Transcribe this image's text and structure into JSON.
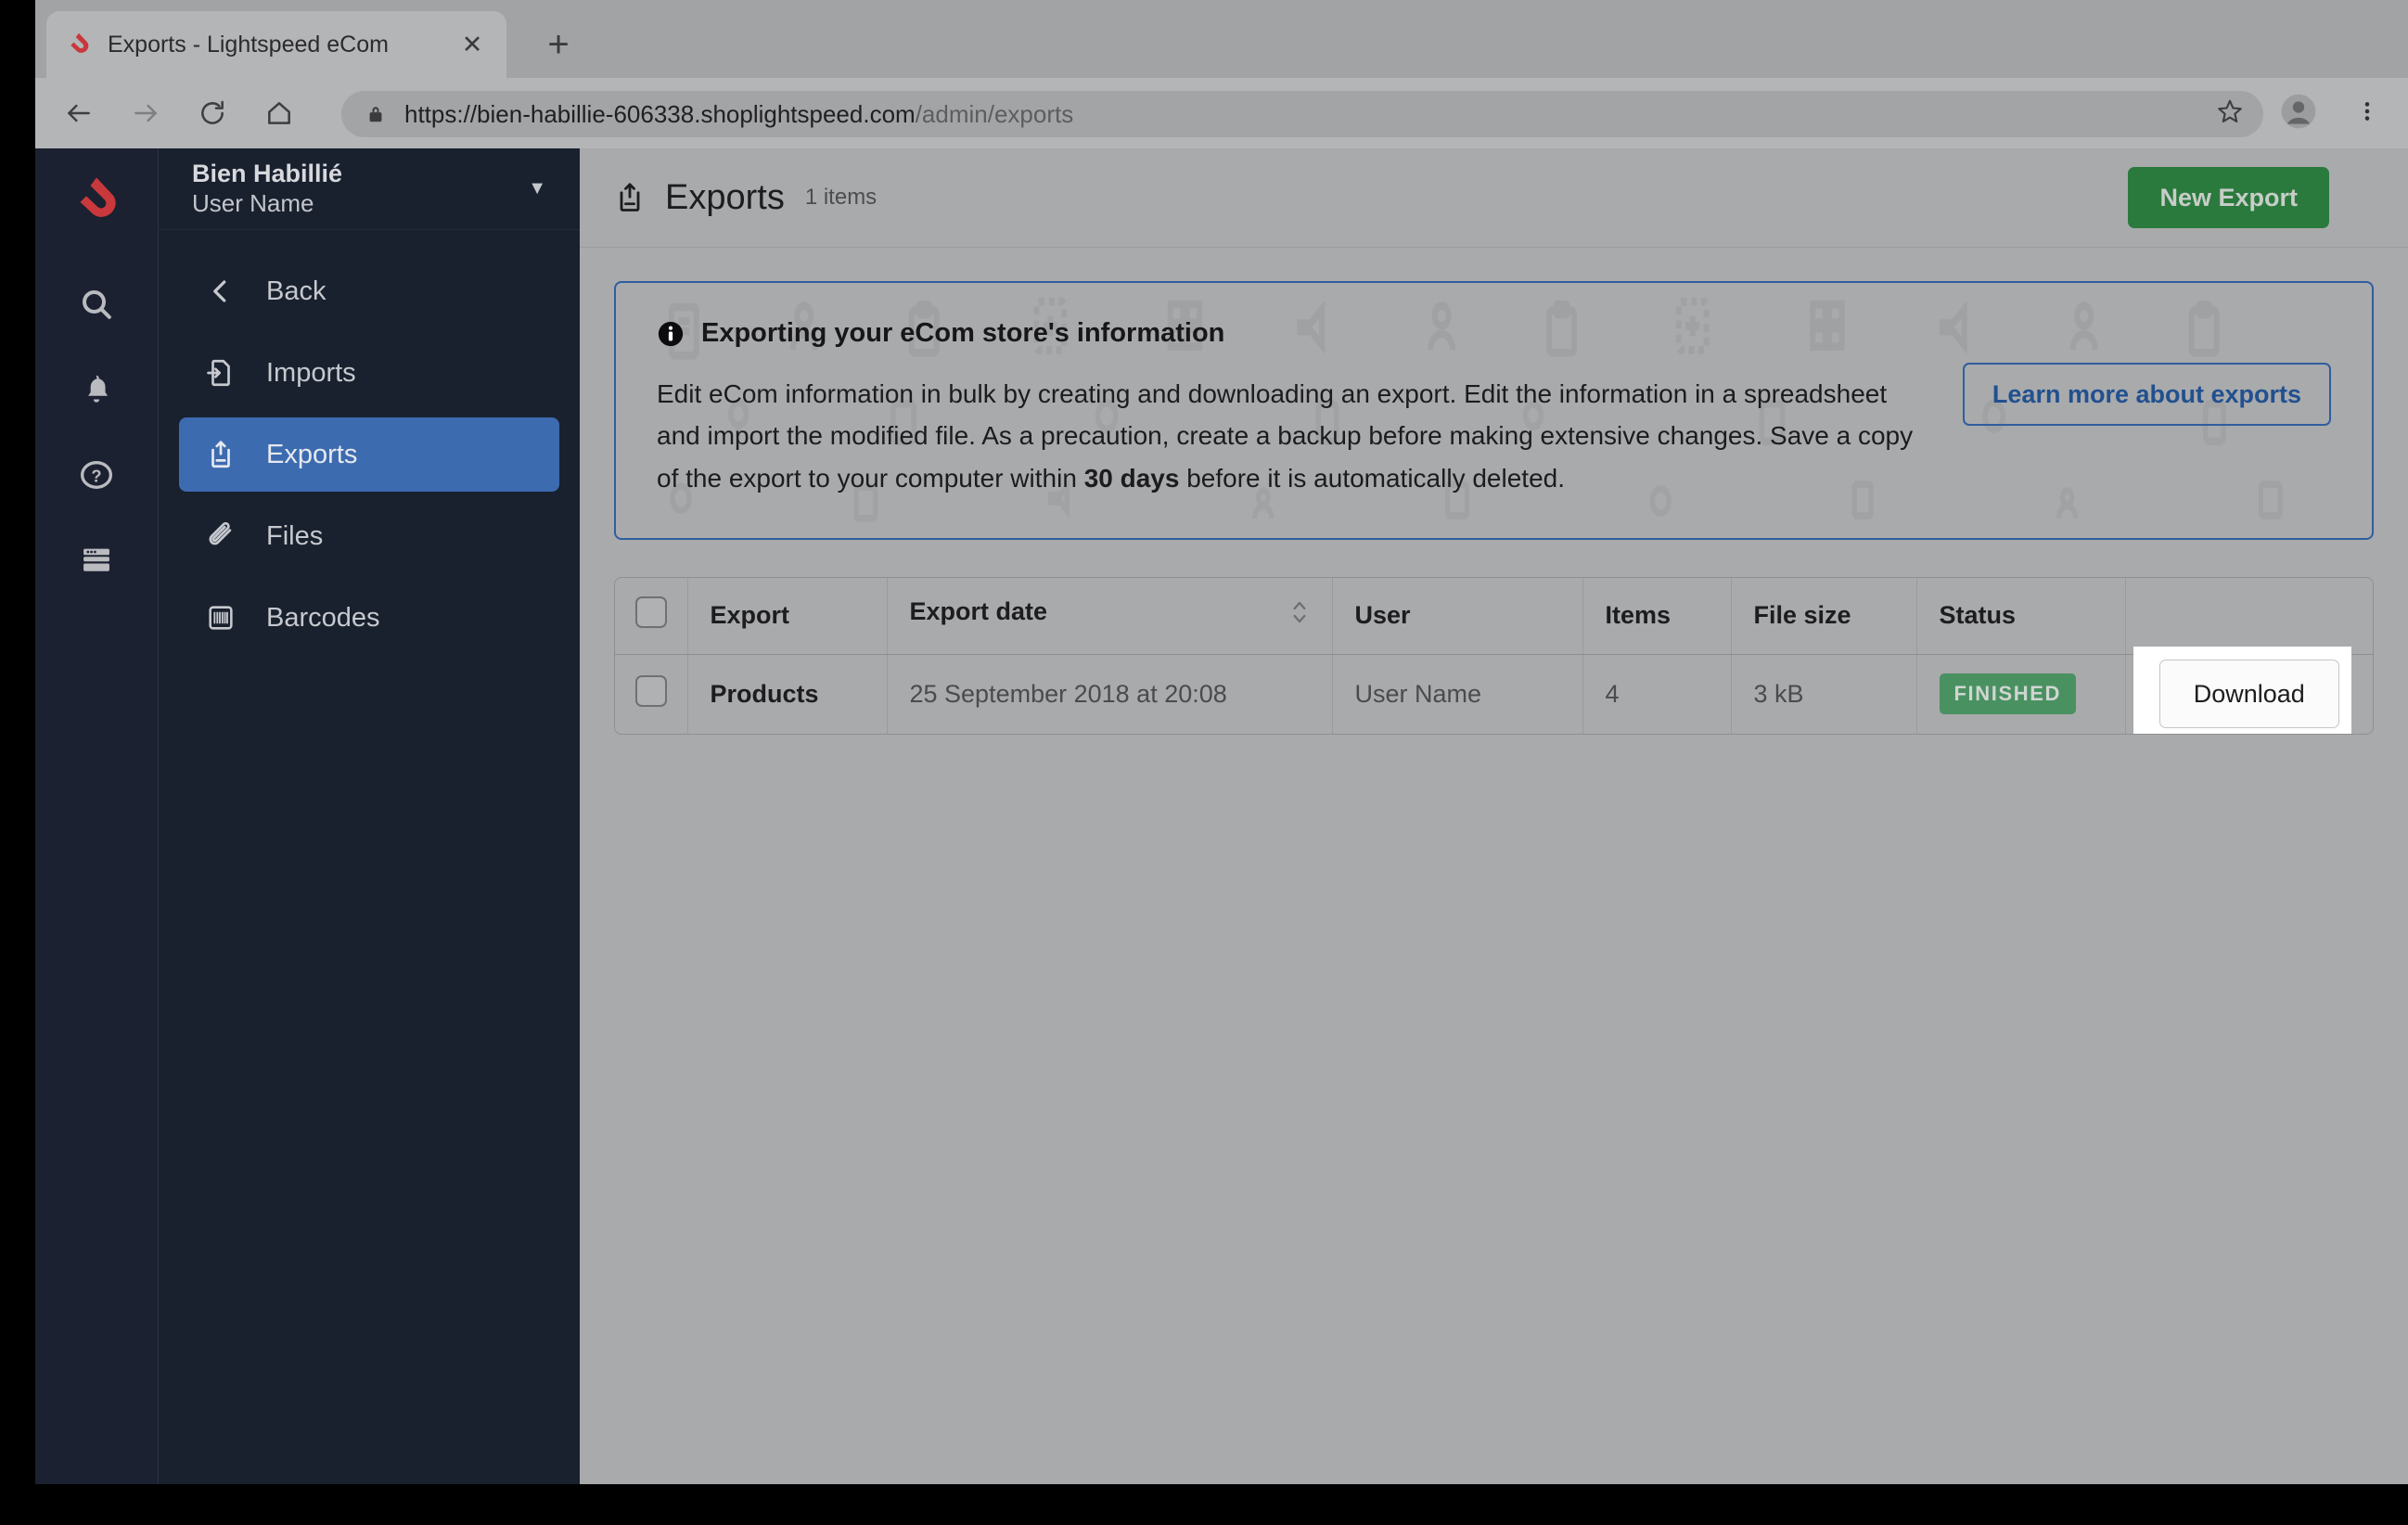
{
  "browser": {
    "tab": {
      "title": "Exports - Lightspeed eCom",
      "favicon_icon": "lightspeed-flame-icon",
      "close_icon": "close-icon"
    },
    "new_tab_label": "+",
    "nav": {
      "back_icon": "back-arrow-icon",
      "forward_icon": "forward-arrow-icon",
      "reload_icon": "reload-icon",
      "home_icon": "home-icon"
    },
    "omnibox": {
      "lock_icon": "lock-icon",
      "url_scheme_host": "https://bien-habillie-606338.shoplightspeed.com",
      "url_path": "/admin/exports"
    },
    "toolbar_right": {
      "bookmark_icon": "star-icon",
      "profile_icon": "profile-avatar-icon",
      "menu_icon": "three-dot-menu-icon"
    }
  },
  "rail": {
    "logo_icon": "lightspeed-logo-icon",
    "items": [
      {
        "icon": "search-icon",
        "name": "search"
      },
      {
        "icon": "bell-icon",
        "name": "notifications"
      },
      {
        "icon": "question-circle-icon",
        "name": "help"
      },
      {
        "icon": "browser-window-icon",
        "name": "storefront"
      }
    ]
  },
  "sidebar": {
    "store_name": "Bien Habillié",
    "user_name": "User Name",
    "dropdown_icon": "chevron-down-icon",
    "items": [
      {
        "label": "Back",
        "icon": "chevron-left-icon",
        "active": false
      },
      {
        "label": "Imports",
        "icon": "import-file-icon",
        "active": false
      },
      {
        "label": "Exports",
        "icon": "export-upload-icon",
        "active": true
      },
      {
        "label": "Files",
        "icon": "paperclip-icon",
        "active": false
      },
      {
        "label": "Barcodes",
        "icon": "barcode-icon",
        "active": false
      }
    ]
  },
  "page": {
    "title_icon": "export-upload-icon",
    "title": "Exports",
    "item_count": "1 items",
    "new_export_label": "New Export"
  },
  "banner": {
    "info_icon": "info-circle-icon",
    "title": "Exporting your eCom store's information",
    "text_part1": "Edit eCom information in bulk by creating and downloading an export. Edit the information in a spreadsheet and import the modified file. As a precaution, create a backup before making extensive changes. Save a copy of the export to your computer within ",
    "text_bold": "30 days",
    "text_part2": " before it is automatically deleted.",
    "cta_label": "Learn more about exports"
  },
  "table": {
    "select_all_icon": "checkbox-icon",
    "sort_icon": "sort-updown-icon",
    "headers": {
      "export": "Export",
      "export_date": "Export date",
      "user": "User",
      "items": "Items",
      "file_size": "File size",
      "status": "Status"
    },
    "rows": [
      {
        "export": "Products",
        "export_date": "25 September 2018 at 20:08",
        "user": "User Name",
        "items": "4",
        "file_size": "3 kB",
        "status": "FINISHED",
        "action_label": "Download"
      }
    ]
  },
  "colors": {
    "brand_red": "#c8383c",
    "sidebar_bg": "#19202e",
    "sidebar_active": "#3d6bb0",
    "primary_green": "#2b7a3d",
    "status_green": "#4a9162",
    "accent_blue": "#2f5e9e"
  }
}
